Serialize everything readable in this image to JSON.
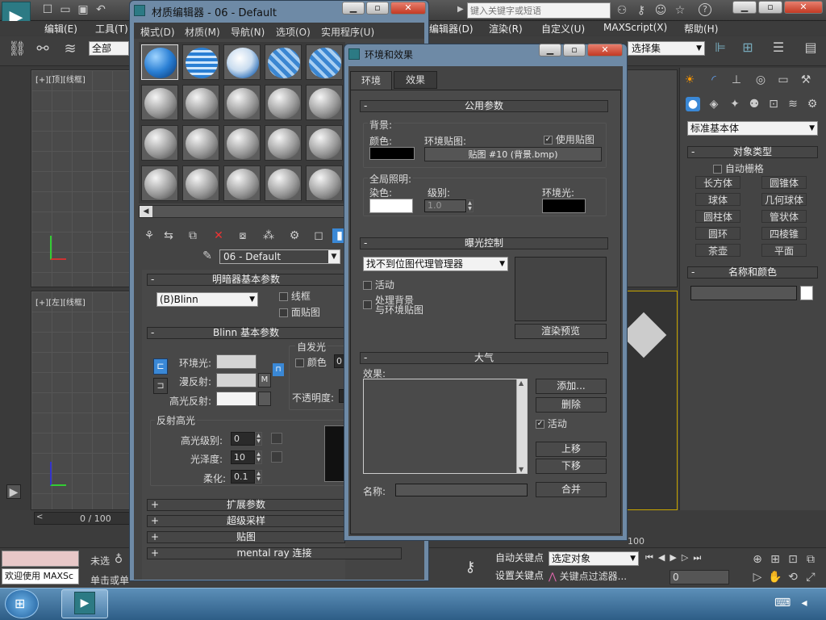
{
  "topbar": {
    "search_placeholder": "键入关键字或短语"
  },
  "main_menu": [
    "编辑(E)",
    "工具(T)",
    "编辑器(D)",
    "渲染(R)",
    "自定义(U)",
    "MAXScript(X)",
    "帮助(H)"
  ],
  "toolbar": {
    "filter": "全部",
    "selection_set": "选择集"
  },
  "viewports": {
    "top": "[+][顶][线框]",
    "left": "[+][左][线框]"
  },
  "material_editor": {
    "title": "材质编辑器 - 06 - Default",
    "menu": [
      "模式(D)",
      "材质(M)",
      "导航(N)",
      "选项(O)",
      "实用程序(U)"
    ],
    "material_name": "06 - Default",
    "shader_rollout": "明暗器基本参数",
    "shader_type": "(B)Blinn",
    "wire": "线框",
    "faceted": "面贴图",
    "blinn_rollout": "Blinn 基本参数",
    "self_illum": "自发光",
    "self_illum_color": "颜色",
    "self_illum_value": "0",
    "ambient": "环境光:",
    "diffuse": "漫反射:",
    "specular": "高光反射:",
    "map_button": "M",
    "opacity": "不透明度:",
    "spec_group": "反射高光",
    "spec_level": "高光级别:",
    "spec_level_value": "0",
    "glossiness": "光泽度:",
    "glossiness_value": "10",
    "soften": "柔化:",
    "soften_value": "0.1",
    "rollouts": [
      "扩展参数",
      "超级采样",
      "贴图",
      "mental ray 连接"
    ]
  },
  "env_dialog": {
    "title": "环境和效果",
    "tabs": [
      "环境",
      "效果"
    ],
    "common": {
      "title": "公用参数",
      "background": "背景:",
      "color": "颜色:",
      "env_map": "环境贴图:",
      "use_map": "使用贴图",
      "map_name": "贴图 #10 (背景.bmp)",
      "global_lighting": "全局照明:",
      "tint": "染色:",
      "level": "级别:",
      "level_value": "1.0",
      "ambient": "环境光:"
    },
    "exposure": {
      "title": "曝光控制",
      "type": "找不到位图代理管理器",
      "active": "活动",
      "process_bg": "处理背景",
      "process_bg2": "与环境贴图",
      "render_preview": "渲染预览"
    },
    "atmosphere": {
      "title": "大气",
      "effects": "效果:",
      "add": "添加...",
      "delete": "删除",
      "active": "活动",
      "move_up": "上移",
      "move_down": "下移",
      "name": "名称:",
      "merge": "合并"
    }
  },
  "command_panel": {
    "dropdown": "标准基本体",
    "object_type": "对象类型",
    "autogrid": "自动栅格",
    "objects": [
      "长方体",
      "圆锥体",
      "球体",
      "几何球体",
      "圆柱体",
      "管状体",
      "圆环",
      "四棱锥",
      "茶壶",
      "平面"
    ],
    "name_color": "名称和颜色"
  },
  "status": {
    "timeline": "0 / 100",
    "timeline_end": "100",
    "welcome": "欢迎使用  MAXSc",
    "unselected": "未选",
    "click_or_drag": "单击或单",
    "autokey": "自动关键点",
    "setkey": "设置关键点",
    "selected_object": "选定对象",
    "key_filters": "关键点过滤器...",
    "frame": "0"
  },
  "colors": {
    "accent": "#3a88d6",
    "bg": "#3a3a3a",
    "panel": "#444444"
  }
}
